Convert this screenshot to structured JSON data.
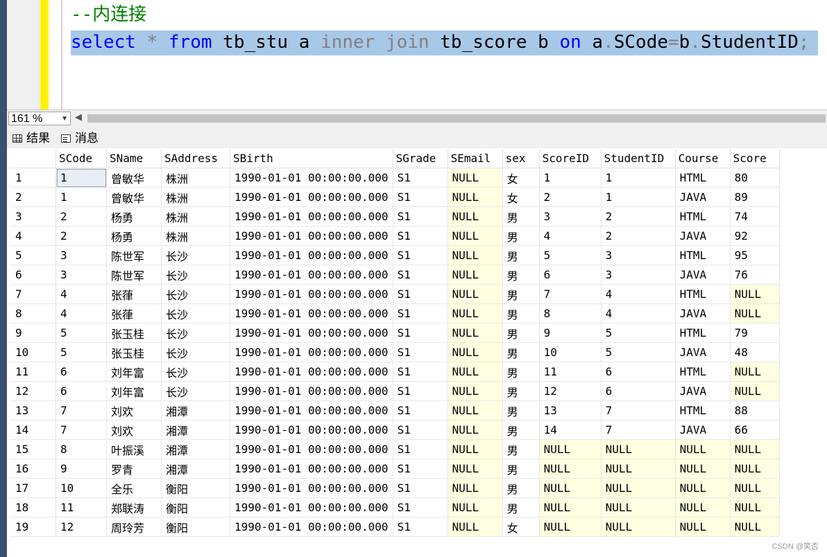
{
  "editor": {
    "comment": "--内连接",
    "sql_tokens": [
      {
        "t": "select",
        "c": "kw"
      },
      {
        "t": " * ",
        "c": "gr"
      },
      {
        "t": "from",
        "c": "kw"
      },
      {
        "t": " tb_stu a ",
        "c": "id"
      },
      {
        "t": "inner join",
        "c": "gr"
      },
      {
        "t": " tb_score b ",
        "c": "id"
      },
      {
        "t": "on",
        "c": "kw"
      },
      {
        "t": " a",
        "c": "id"
      },
      {
        "t": ".",
        "c": "gr"
      },
      {
        "t": "SCode",
        "c": "id"
      },
      {
        "t": "=",
        "c": "gr"
      },
      {
        "t": "b",
        "c": "id"
      },
      {
        "t": ".",
        "c": "gr"
      },
      {
        "t": "StudentID",
        "c": "id"
      },
      {
        "t": ";",
        "c": "gr"
      }
    ]
  },
  "zoom": {
    "value": "161 %"
  },
  "tabs": {
    "results": "结果",
    "messages": "消息"
  },
  "grid": {
    "columns": [
      "SCode",
      "SName",
      "SAddress",
      "SBirth",
      "SGrade",
      "SEmail",
      "sex",
      "ScoreID",
      "StudentID",
      "Course",
      "Score"
    ],
    "rows": [
      [
        "1",
        "1",
        "曾敏华",
        "株洲",
        "1990-01-01 00:00:00.000",
        "S1",
        "NULL",
        "女",
        "1",
        "1",
        "HTML",
        "80"
      ],
      [
        "2",
        "1",
        "曾敏华",
        "株洲",
        "1990-01-01 00:00:00.000",
        "S1",
        "NULL",
        "女",
        "2",
        "1",
        "JAVA",
        "89"
      ],
      [
        "3",
        "2",
        "杨勇",
        "株洲",
        "1990-01-01 00:00:00.000",
        "S1",
        "NULL",
        "男",
        "3",
        "2",
        "HTML",
        "74"
      ],
      [
        "4",
        "2",
        "杨勇",
        "株洲",
        "1990-01-01 00:00:00.000",
        "S1",
        "NULL",
        "男",
        "4",
        "2",
        "JAVA",
        "92"
      ],
      [
        "5",
        "3",
        "陈世军",
        "长沙",
        "1990-01-01 00:00:00.000",
        "S1",
        "NULL",
        "男",
        "5",
        "3",
        "HTML",
        "95"
      ],
      [
        "6",
        "3",
        "陈世军",
        "长沙",
        "1990-01-01 00:00:00.000",
        "S1",
        "NULL",
        "男",
        "6",
        "3",
        "JAVA",
        "76"
      ],
      [
        "7",
        "4",
        "张葎",
        "长沙",
        "1990-01-01 00:00:00.000",
        "S1",
        "NULL",
        "男",
        "7",
        "4",
        "HTML",
        "NULL"
      ],
      [
        "8",
        "4",
        "张葎",
        "长沙",
        "1990-01-01 00:00:00.000",
        "S1",
        "NULL",
        "男",
        "8",
        "4",
        "JAVA",
        "NULL"
      ],
      [
        "9",
        "5",
        "张玉桂",
        "长沙",
        "1990-01-01 00:00:00.000",
        "S1",
        "NULL",
        "男",
        "9",
        "5",
        "HTML",
        "79"
      ],
      [
        "10",
        "5",
        "张玉桂",
        "长沙",
        "1990-01-01 00:00:00.000",
        "S1",
        "NULL",
        "男",
        "10",
        "5",
        "JAVA",
        "48"
      ],
      [
        "11",
        "6",
        "刘年富",
        "长沙",
        "1990-01-01 00:00:00.000",
        "S1",
        "NULL",
        "男",
        "11",
        "6",
        "HTML",
        "NULL"
      ],
      [
        "12",
        "6",
        "刘年富",
        "长沙",
        "1990-01-01 00:00:00.000",
        "S1",
        "NULL",
        "男",
        "12",
        "6",
        "JAVA",
        "NULL"
      ],
      [
        "13",
        "7",
        "刘欢",
        "湘潭",
        "1990-01-01 00:00:00.000",
        "S1",
        "NULL",
        "男",
        "13",
        "7",
        "HTML",
        "88"
      ],
      [
        "14",
        "7",
        "刘欢",
        "湘潭",
        "1990-01-01 00:00:00.000",
        "S1",
        "NULL",
        "男",
        "14",
        "7",
        "JAVA",
        "66"
      ],
      [
        "15",
        "8",
        "叶振溪",
        "湘潭",
        "1990-01-01 00:00:00.000",
        "S1",
        "NULL",
        "男",
        "NULL",
        "NULL",
        "NULL",
        "NULL"
      ],
      [
        "16",
        "9",
        "罗青",
        "湘潭",
        "1990-01-01 00:00:00.000",
        "S1",
        "NULL",
        "男",
        "NULL",
        "NULL",
        "NULL",
        "NULL"
      ],
      [
        "17",
        "10",
        "全乐",
        "衡阳",
        "1990-01-01 00:00:00.000",
        "S1",
        "NULL",
        "男",
        "NULL",
        "NULL",
        "NULL",
        "NULL"
      ],
      [
        "18",
        "11",
        "郑联涛",
        "衡阳",
        "1990-01-01 00:00:00.000",
        "S1",
        "NULL",
        "男",
        "NULL",
        "NULL",
        "NULL",
        "NULL"
      ],
      [
        "19",
        "12",
        "周玲芳",
        "衡阳",
        "1990-01-01 00:00:00.000",
        "S1",
        "NULL",
        "女",
        "NULL",
        "NULL",
        "NULL",
        "NULL"
      ]
    ]
  },
  "watermark": "CSDN @笑否"
}
